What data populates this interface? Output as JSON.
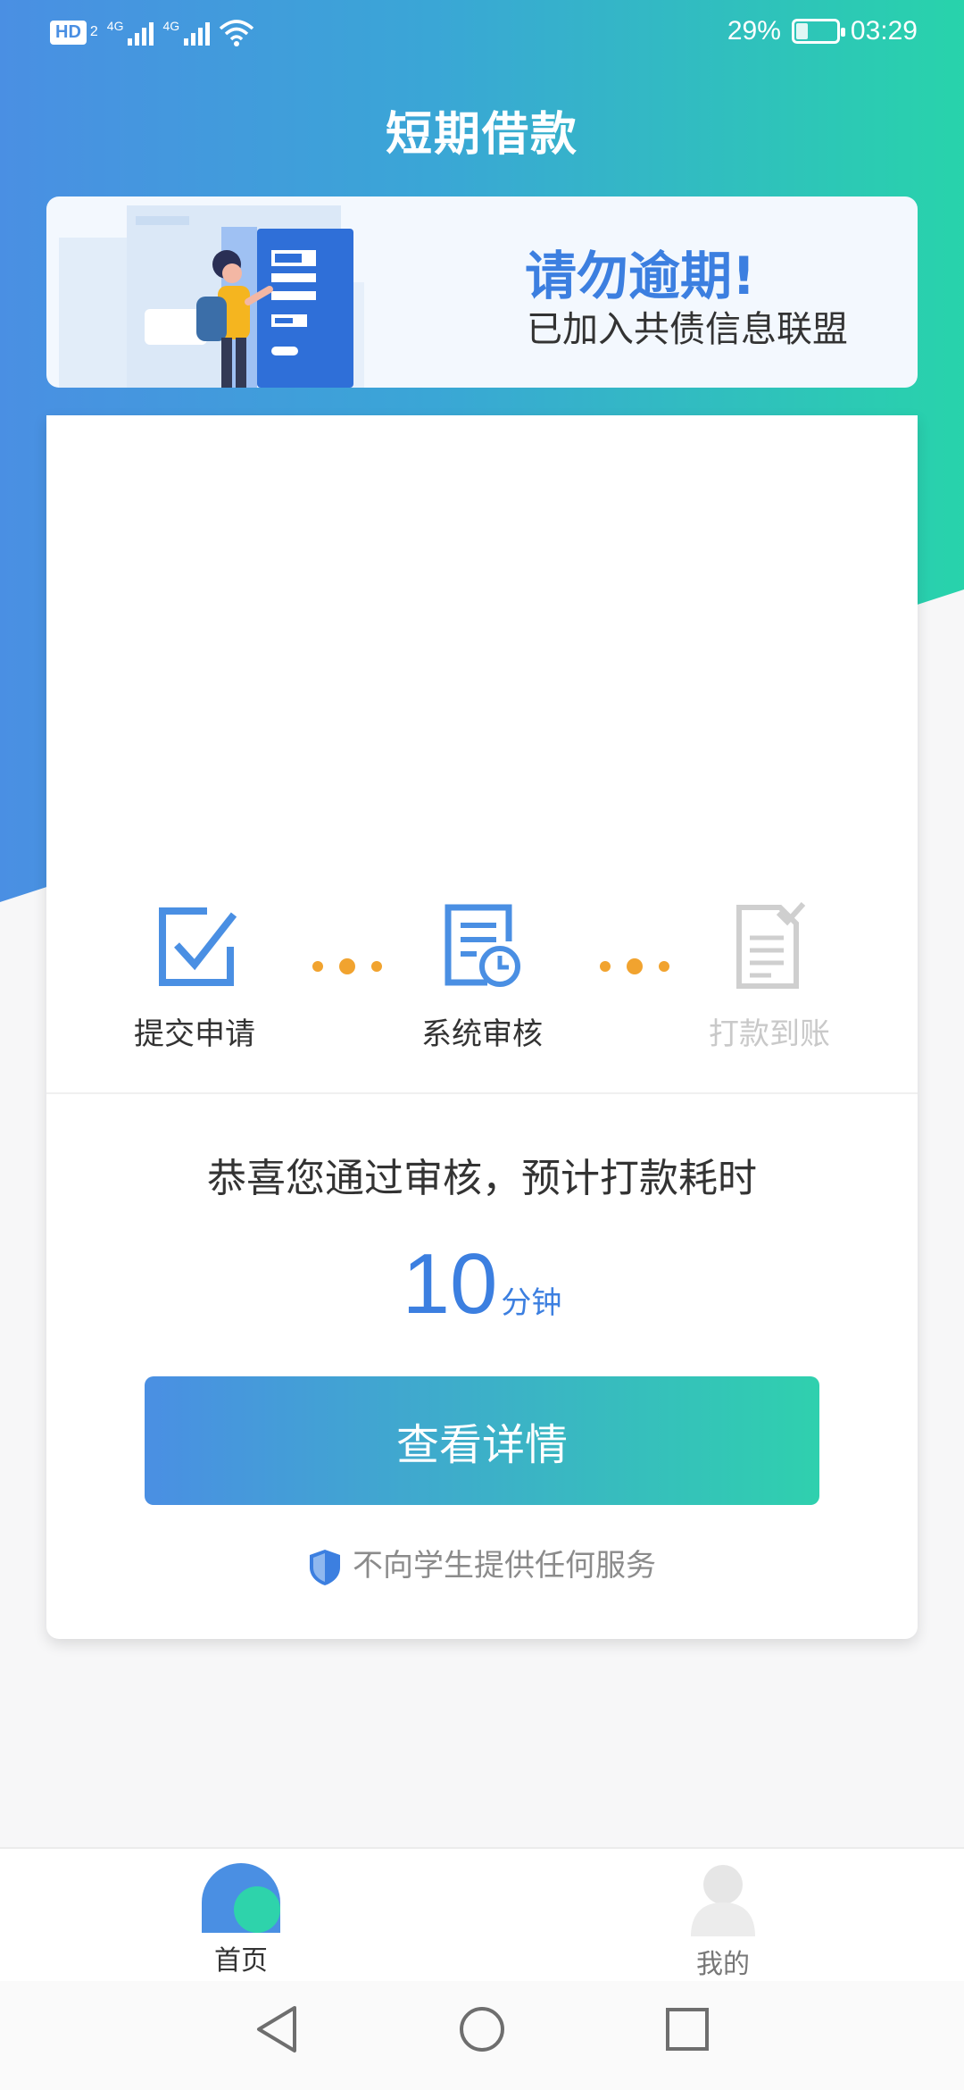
{
  "status_bar": {
    "hd_label": "HD",
    "hd_sub": "2",
    "network_1": "4G",
    "network_2": "4G",
    "battery_percent": "29%",
    "battery_level": 0.29,
    "time": "03:29"
  },
  "header": {
    "title": "短期借款"
  },
  "banner": {
    "headline": "请勿逾期!",
    "subline": "已加入共债信息联盟"
  },
  "steps": [
    {
      "label": "提交申请",
      "icon": "checkbox-icon",
      "active": true
    },
    {
      "label": "系统审核",
      "icon": "document-clock-icon",
      "active": true
    },
    {
      "label": "打款到账",
      "icon": "document-check-icon",
      "active": false
    }
  ],
  "result": {
    "message": "恭喜您通过审核，预计打款耗时",
    "time_value": "10",
    "time_unit": "分钟"
  },
  "cta": {
    "label": "查看详情"
  },
  "notice": {
    "text": "不向学生提供任何服务",
    "icon": "shield-icon"
  },
  "tabbar": {
    "items": [
      {
        "label": "首页",
        "icon": "home-tab-icon",
        "active": true
      },
      {
        "label": "我的",
        "icon": "profile-tab-icon",
        "active": false
      }
    ]
  },
  "nav": {
    "back": "back-icon",
    "home": "home-circle-icon",
    "recents": "recents-icon"
  },
  "colors": {
    "primary_blue": "#4a8fe3",
    "accent_green": "#28d3ab",
    "accent_text_blue": "#3c7fe0",
    "dot_orange": "#f1a32f",
    "inactive_gray": "#c9c9c9"
  }
}
